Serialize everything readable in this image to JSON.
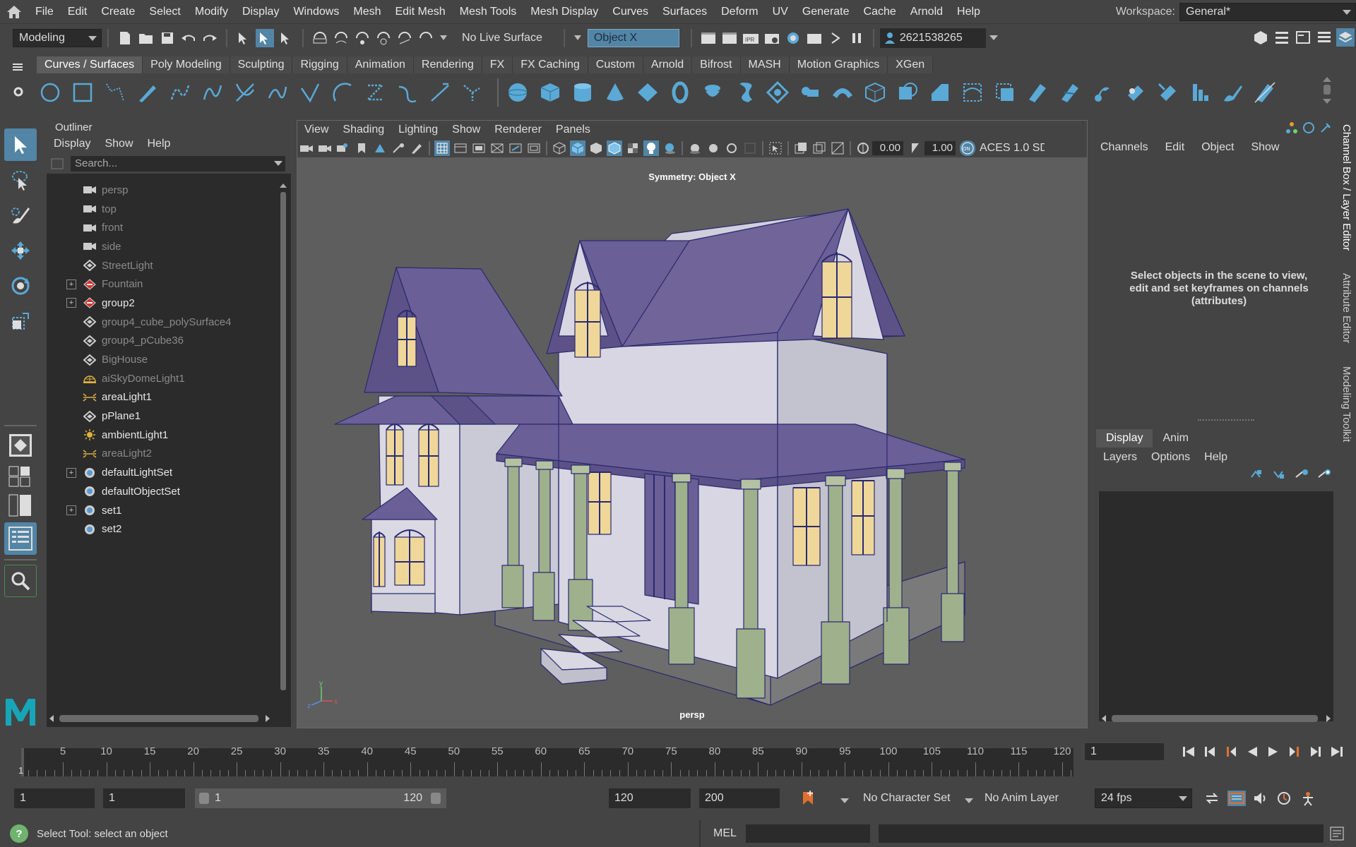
{
  "menubar": {
    "items": [
      "File",
      "Edit",
      "Create",
      "Select",
      "Modify",
      "Display",
      "Windows",
      "Mesh",
      "Edit Mesh",
      "Mesh Tools",
      "Mesh Display",
      "Curves",
      "Surfaces",
      "Deform",
      "UV",
      "Generate",
      "Cache",
      "Arnold",
      "Help"
    ],
    "workspace_label": "Workspace:",
    "workspace_value": "General*"
  },
  "statusline": {
    "mode": "Modeling",
    "live_surface": "No Live Surface",
    "symmetry": "Object X",
    "user_id": "2621538265"
  },
  "shelf": {
    "tabs": [
      "Curves / Surfaces",
      "Poly Modeling",
      "Sculpting",
      "Rigging",
      "Animation",
      "Rendering",
      "FX",
      "FX Caching",
      "Custom",
      "Arnold",
      "Bifrost",
      "MASH",
      "Motion Graphics",
      "XGen"
    ],
    "active": "Curves / Surfaces"
  },
  "outliner": {
    "title": "Outliner",
    "menu": [
      "Display",
      "Show",
      "Help"
    ],
    "search_placeholder": "Search...",
    "items": [
      {
        "label": "persp",
        "icon": "camera-icon",
        "dim": true,
        "expandable": false
      },
      {
        "label": "top",
        "icon": "camera-icon",
        "dim": true,
        "expandable": false
      },
      {
        "label": "front",
        "icon": "camera-icon",
        "dim": true,
        "expandable": false
      },
      {
        "label": "side",
        "icon": "camera-icon",
        "dim": true,
        "expandable": false
      },
      {
        "label": "StreetLight",
        "icon": "transform-icon",
        "dim": true,
        "expandable": false
      },
      {
        "label": "Fountain",
        "icon": "group-icon",
        "dim": true,
        "expandable": true
      },
      {
        "label": "group2",
        "icon": "group-icon",
        "dim": false,
        "expandable": true
      },
      {
        "label": "group4_cube_polySurface4",
        "icon": "transform-icon",
        "dim": true,
        "expandable": false
      },
      {
        "label": "group4_pCube36",
        "icon": "transform-icon",
        "dim": true,
        "expandable": false
      },
      {
        "label": "BigHouse",
        "icon": "transform-icon",
        "dim": true,
        "expandable": false
      },
      {
        "label": "aiSkyDomeLight1",
        "icon": "skydome-icon",
        "dim": true,
        "expandable": false
      },
      {
        "label": "areaLight1",
        "icon": "area-light-icon",
        "dim": false,
        "expandable": false
      },
      {
        "label": "pPlane1",
        "icon": "transform-icon",
        "dim": false,
        "expandable": false
      },
      {
        "label": "ambientLight1",
        "icon": "ambient-light-icon",
        "dim": false,
        "expandable": false
      },
      {
        "label": "areaLight2",
        "icon": "area-light-icon",
        "dim": true,
        "expandable": false
      },
      {
        "label": "defaultLightSet",
        "icon": "set-icon",
        "dim": false,
        "expandable": true
      },
      {
        "label": "defaultObjectSet",
        "icon": "set-icon",
        "dim": false,
        "expandable": false
      },
      {
        "label": "set1",
        "icon": "set-icon",
        "dim": false,
        "expandable": true
      },
      {
        "label": "set2",
        "icon": "set-icon",
        "dim": false,
        "expandable": false
      }
    ]
  },
  "viewport": {
    "menu": [
      "View",
      "Shading",
      "Lighting",
      "Show",
      "Renderer",
      "Panels"
    ],
    "value_a": "0.00",
    "value_b": "1.00",
    "color_space": "ACES 1.0 SD",
    "symmetry_label": "Symmetry: Object X",
    "camera_label": "persp"
  },
  "channelbox": {
    "menu": [
      "Channels",
      "Edit",
      "Object",
      "Show"
    ],
    "message": "Select objects in the scene to view, edit and set keyframes on channels (attributes)",
    "layer_tabs": [
      "Display",
      "Anim"
    ],
    "layer_menu": [
      "Layers",
      "Options",
      "Help"
    ],
    "side_tabs": [
      "Channel Box / Layer Editor",
      "Attribute Editor",
      "Modeling Toolkit"
    ]
  },
  "timeline": {
    "ticks": [
      5,
      10,
      15,
      20,
      25,
      30,
      35,
      40,
      45,
      50,
      55,
      60,
      65,
      70,
      75,
      80,
      85,
      90,
      95,
      100,
      105,
      110,
      115,
      120
    ],
    "current_frame_marker": "1",
    "current_frame_field": "1"
  },
  "range": {
    "start": "1",
    "anim_start": "1",
    "slider_start": "1",
    "slider_end": "120",
    "end": "120",
    "anim_end": "200",
    "character_set": "No Character Set",
    "anim_layer": "No Anim Layer",
    "fps": "24 fps"
  },
  "commandline": {
    "help_text": "Select Tool: select an object",
    "language": "MEL"
  },
  "colors": {
    "accent": "#5285a6",
    "roof": "#6a5f96",
    "wall": "#dcdce4",
    "pillar": "#9fb08c",
    "window": "#efd79a",
    "outline": "#2a2a6e"
  }
}
